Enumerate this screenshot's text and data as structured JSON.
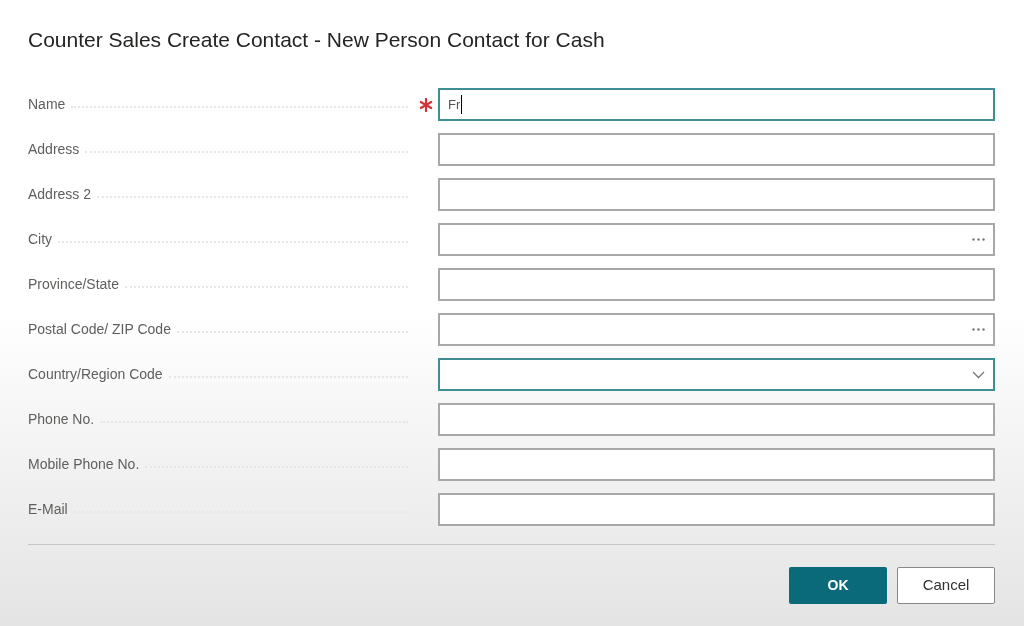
{
  "dialog": {
    "title": "Counter Sales Create Contact - New Person Contact for Cash"
  },
  "fields": [
    {
      "label": "Name",
      "kind": "text",
      "required": true,
      "focused": true,
      "value": "Fr"
    },
    {
      "label": "Address",
      "kind": "text",
      "required": false,
      "focused": false
    },
    {
      "label": "Address 2",
      "kind": "text",
      "required": false,
      "focused": false
    },
    {
      "label": "City",
      "kind": "lookup",
      "required": false,
      "focused": false
    },
    {
      "label": "Province/State",
      "kind": "text",
      "required": false,
      "focused": false
    },
    {
      "label": "Postal Code/ ZIP Code",
      "kind": "lookup",
      "required": false,
      "focused": false
    },
    {
      "label": "Country/Region Code",
      "kind": "dropdown",
      "required": false,
      "focused": true
    },
    {
      "label": "Phone No.",
      "kind": "text",
      "required": false,
      "focused": false
    },
    {
      "label": "Mobile Phone No.",
      "kind": "text",
      "required": false,
      "focused": false
    },
    {
      "label": "E-Mail",
      "kind": "text",
      "required": false,
      "focused": false
    }
  ],
  "buttons": [
    {
      "label": "OK",
      "kind": "primary"
    },
    {
      "label": "Cancel",
      "kind": "secondary"
    }
  ]
}
